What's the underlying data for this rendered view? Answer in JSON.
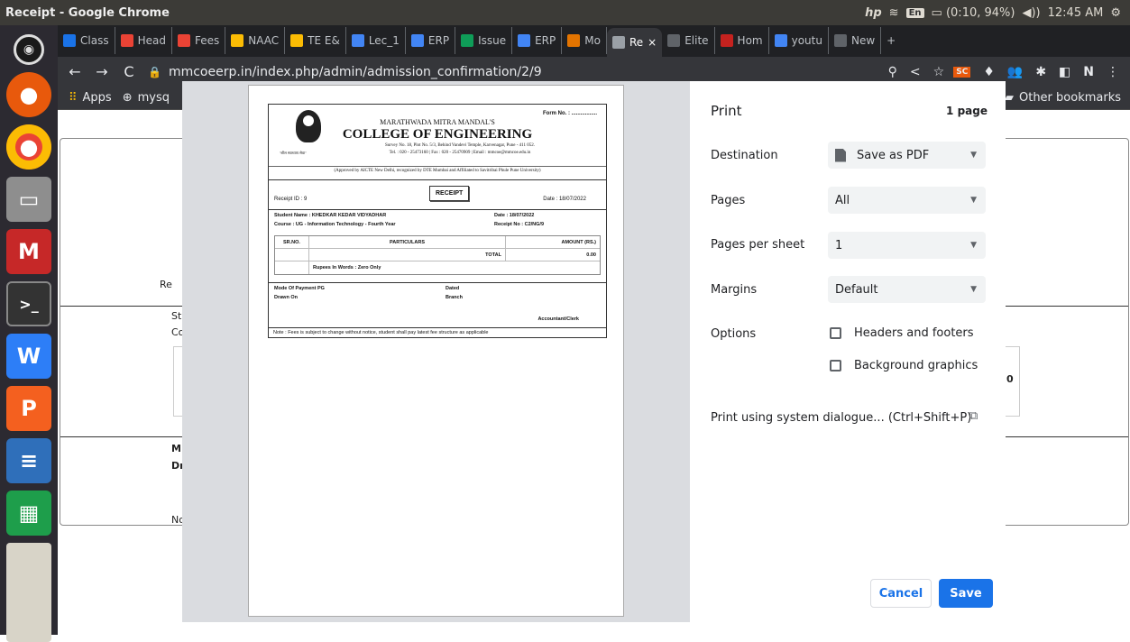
{
  "window": {
    "title": "Receipt - Google Chrome",
    "lang": "En",
    "battery": "(0:10, 94%)",
    "clock": "12:45 AM"
  },
  "tabs": [
    {
      "label": "Class",
      "color": "#1a73e8"
    },
    {
      "label": "Head",
      "color": "#ea4335"
    },
    {
      "label": "Fees",
      "color": "#ea4335"
    },
    {
      "label": "NAAC",
      "color": "#fbbc04"
    },
    {
      "label": "TE E&",
      "color": "#fbbc04"
    },
    {
      "label": "Lec_1",
      "color": "#4285f4"
    },
    {
      "label": "ERP",
      "color": "#4285f4"
    },
    {
      "label": "Issue",
      "color": "#0f9d58"
    },
    {
      "label": "ERP",
      "color": "#4285f4"
    },
    {
      "label": "Mo",
      "color": "#e37400"
    },
    {
      "label": "Re",
      "color": "#9aa0a6"
    },
    {
      "label": "Elite",
      "color": "#5f6368"
    },
    {
      "label": "Hom",
      "color": "#c5221f"
    },
    {
      "label": "youtu",
      "color": "#4285f4"
    },
    {
      "label": "New",
      "color": "#5f6368"
    }
  ],
  "address": {
    "url": "mmcoeerp.in/index.php/admin/admission_confirmation/2/9"
  },
  "bookmarks": {
    "apps": "Apps",
    "mysq": "mysq",
    "other": "Other bookmarks"
  },
  "receipt": {
    "form_no": "Form No. : .................",
    "mandal": "MARATHWADA MITRA MANDAL'S",
    "college": "COLLEGE OF ENGINEERING",
    "address": "Survey No. 18, Plot No. 5/3, Behind Vandevi Temple, Karvenagar, Pune - 411 052.",
    "tel": "Tel. : 020 - 25473160 | Fax : 020 - 25470909 | Email : mmcoe@mmcoe.edu.in",
    "approved": "(Approved by AICTE New Delhi, recognized by DTE Mumbai and Affiliated to Savitribai Phule Pune University)",
    "receipt_id": "Receipt ID : 9",
    "receipt_title": "RECEIPT",
    "date": "Date : 18/07/2022",
    "student_name": "Student Name  :  KHEDKAR KEDAR VIDYADHAR",
    "date2": "Date : 18/07/2022",
    "course": "Course : UG - Information Technology - Fourth Year",
    "receipt_no": "Receipt No : C2/NG/9",
    "col_srno": "SR.NO.",
    "col_particulars": "PARTICULARS",
    "col_amount": "AMOUNT (RS.)",
    "total_label": "TOTAL",
    "total_value": "0.00",
    "in_words": "Rupees In Words : Zero Only",
    "mode": "Mode Of Payment PG",
    "dated": "Dated",
    "drawn": "Drawn On",
    "branch": "Branch",
    "accountant": "Accountant/Clerk",
    "note": "Note : Fees is subject to change without notice, student shall pay latest fee structure as applicable"
  },
  "print": {
    "title": "Print",
    "pages_count": "1 page",
    "destination_label": "Destination",
    "destination_value": "Save as PDF",
    "pages_label": "Pages",
    "pages_value": "All",
    "pps_label": "Pages per sheet",
    "pps_value": "1",
    "margins_label": "Margins",
    "margins_value": "Default",
    "options_label": "Options",
    "headers_footers": "Headers and footers",
    "background_graphics": "Background graphics",
    "system_dialog": "Print using system dialogue... (Ctrl+Shift+P)",
    "cancel": "Cancel",
    "save": "Save"
  },
  "background": {
    "re": "Re",
    "st": "St",
    "co": "Co",
    "mo": "M",
    "dr": "Dr",
    "no": "No",
    "zero": "0"
  }
}
